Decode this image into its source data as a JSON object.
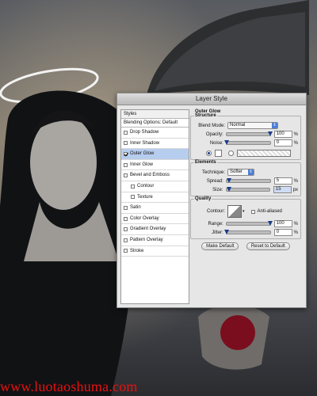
{
  "dialog": {
    "title": "Layer Style"
  },
  "styles_panel": {
    "header": "Styles",
    "blending_options": "Blending Options: Default",
    "items": [
      {
        "label": "Drop Shadow",
        "checked": false,
        "selected": false,
        "indent": false
      },
      {
        "label": "Inner Shadow",
        "checked": false,
        "selected": false,
        "indent": false
      },
      {
        "label": "Outer Glow",
        "checked": true,
        "selected": true,
        "indent": false
      },
      {
        "label": "Inner Glow",
        "checked": false,
        "selected": false,
        "indent": false
      },
      {
        "label": "Bevel and Emboss",
        "checked": false,
        "selected": false,
        "indent": false
      },
      {
        "label": "Contour",
        "checked": false,
        "selected": false,
        "indent": true
      },
      {
        "label": "Texture",
        "checked": false,
        "selected": false,
        "indent": true
      },
      {
        "label": "Satin",
        "checked": false,
        "selected": false,
        "indent": false
      },
      {
        "label": "Color Overlay",
        "checked": false,
        "selected": false,
        "indent": false
      },
      {
        "label": "Gradient Overlay",
        "checked": false,
        "selected": false,
        "indent": false
      },
      {
        "label": "Pattern Overlay",
        "checked": false,
        "selected": false,
        "indent": false
      },
      {
        "label": "Stroke",
        "checked": false,
        "selected": false,
        "indent": false
      }
    ]
  },
  "outer_glow": {
    "section_title": "Outer Glow",
    "structure": {
      "title": "Structure",
      "blend_mode_label": "Blend Mode:",
      "blend_mode_value": "Normal",
      "opacity_label": "Opacity:",
      "opacity_value": "100",
      "opacity_unit": "%",
      "opacity_level": 1.0,
      "noise_label": "Noise:",
      "noise_value": "0",
      "noise_unit": "%",
      "noise_level": 0.0
    },
    "elements": {
      "title": "Elements",
      "technique_label": "Technique:",
      "technique_value": "Softer",
      "spread_label": "Spread:",
      "spread_value": "5",
      "spread_unit": "%",
      "spread_level": 0.05,
      "size_label": "Size:",
      "size_value": "15",
      "size_unit": "px",
      "size_level": 0.06
    },
    "quality": {
      "title": "Quality",
      "contour_label": "Contour:",
      "anti_aliased_label": "Anti-aliased",
      "range_label": "Range:",
      "range_value": "100",
      "range_unit": "%",
      "range_level": 1.0,
      "jitter_label": "Jitter:",
      "jitter_value": "0",
      "jitter_unit": "%",
      "jitter_level": 0.0
    },
    "make_default_label": "Make Default",
    "reset_default_label": "Reset to Default"
  },
  "watermark": "www.luotaoshuma.com",
  "colors": {
    "selection": "#b7cdee",
    "watermark": "#e81111",
    "accent": "#4d7fd6"
  }
}
